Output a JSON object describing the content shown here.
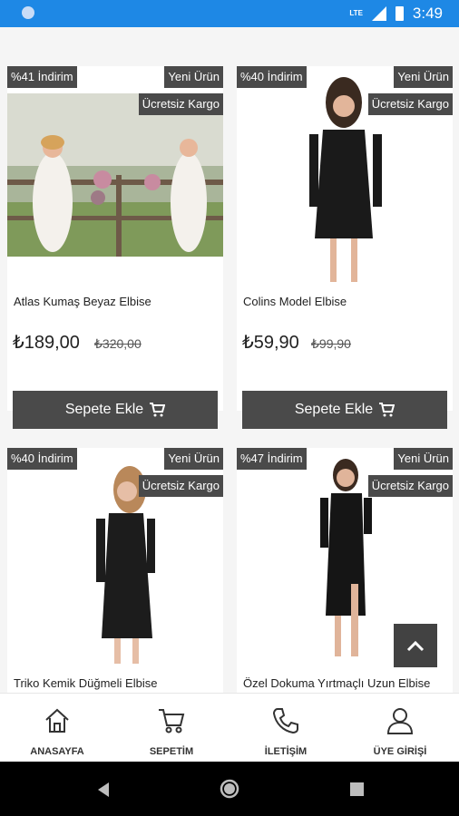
{
  "status_bar": {
    "time": "3:49",
    "network": "LTE"
  },
  "products": [
    {
      "discount": "%41 İndirim",
      "new_label": "Yeni Ürün",
      "shipping_label": "Ücretsiz Kargo",
      "name": "Atlas Kumaş Beyaz Elbise",
      "price": "₺189,00",
      "old_price": "₺320,00",
      "button": "Sepete Ekle"
    },
    {
      "discount": "%40 İndirim",
      "new_label": "Yeni Ürün",
      "shipping_label": "Ücretsiz Kargo",
      "name": "Colins Model Elbise",
      "price": "₺59,90",
      "old_price": "₺99,90",
      "button": "Sepete Ekle"
    },
    {
      "discount": "%40 İndirim",
      "new_label": "Yeni Ürün",
      "shipping_label": "Ücretsiz Kargo",
      "name": "Triko Kemik Düğmeli Elbise"
    },
    {
      "discount": "%47 İndirim",
      "new_label": "Yeni Ürün",
      "shipping_label": "Ücretsiz Kargo",
      "name": "Özel Dokuma Yırtmaçlı Uzun Elbise"
    }
  ],
  "bottom_nav": [
    {
      "label": "ANASAYFA",
      "icon": "home-icon"
    },
    {
      "label": "SEPETİM",
      "icon": "cart-icon"
    },
    {
      "label": "İLETİŞİM",
      "icon": "phone-icon"
    },
    {
      "label": "ÜYE GİRİŞİ",
      "icon": "user-icon"
    }
  ],
  "colors": {
    "status_bar": "#1e88e5",
    "badge": "#4a4a4a",
    "button": "#4a4a4a",
    "background": "#f5f5f5"
  }
}
